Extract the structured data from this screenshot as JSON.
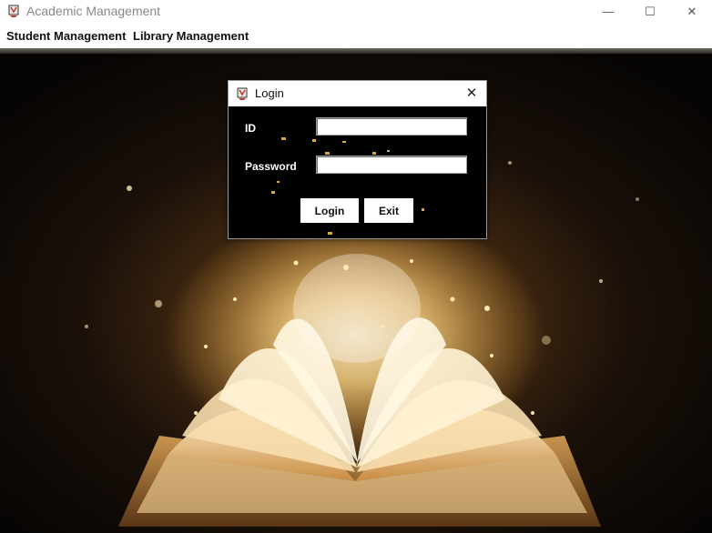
{
  "window": {
    "title": "Academic Management"
  },
  "menu": {
    "items": [
      "Student Management",
      "Library Management"
    ]
  },
  "window_controls": {
    "minimize": "—",
    "maximize": "☐",
    "close": "✕"
  },
  "dialog": {
    "title": "Login",
    "close": "✕",
    "id_label": "ID",
    "id_value": "",
    "password_label": "Password",
    "password_value": "",
    "login_button": "Login",
    "exit_button": "Exit"
  },
  "colors": {
    "titlebar": "#ffffff",
    "dialog_bg": "#000000",
    "glow": "#ffd98a"
  },
  "icons": {
    "app": "java-cup-icon",
    "dialog": "java-cup-icon"
  }
}
